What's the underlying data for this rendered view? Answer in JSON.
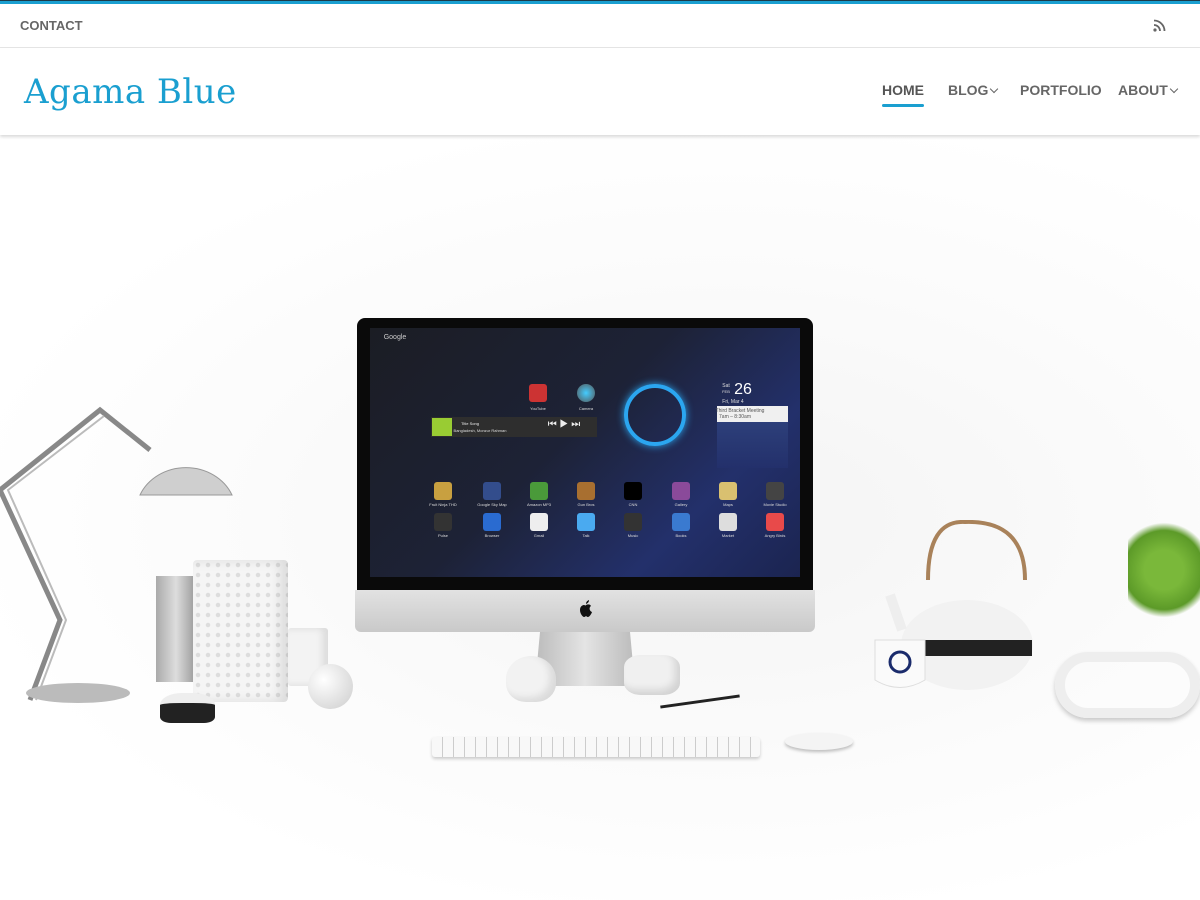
{
  "topbar": {
    "contact_label": "CONTACT",
    "rss_icon": "rss-icon"
  },
  "header": {
    "site_title": "Agama Blue",
    "accent_color": "#1a9fd0",
    "nav": [
      {
        "label": "HOME",
        "active": true
      },
      {
        "label": "BLOG",
        "has_dropdown": true
      },
      {
        "label": "PORTFOLIO"
      },
      {
        "label": "ABOUT",
        "has_dropdown": true
      }
    ]
  },
  "hero": {
    "screen": {
      "search_label": "Google",
      "widget_date_day": "26",
      "widget_date_dow": "Sat",
      "widget_date_month": "FEB",
      "widget_event_date": "Fri, Mar 4",
      "widget_event_title": "Third Bracket Meeting",
      "widget_event_time": "7am – 8:30am",
      "music_title": "Title Song",
      "music_artist": "Bangladesh, Monzur Rahman",
      "top_apps": [
        "YouTube",
        "Camera"
      ],
      "apps_row1": [
        "Fruit Ninja THD",
        "Google Sky Map",
        "Amazon MP3",
        "Gun Bros",
        "CNN",
        "Gallery",
        "Maps",
        "Movie Studio"
      ],
      "apps_row2": [
        "Pulse",
        "Browser",
        "Gmail",
        "Talk",
        "Music",
        "Books",
        "Market",
        "Angry Birds"
      ]
    }
  }
}
